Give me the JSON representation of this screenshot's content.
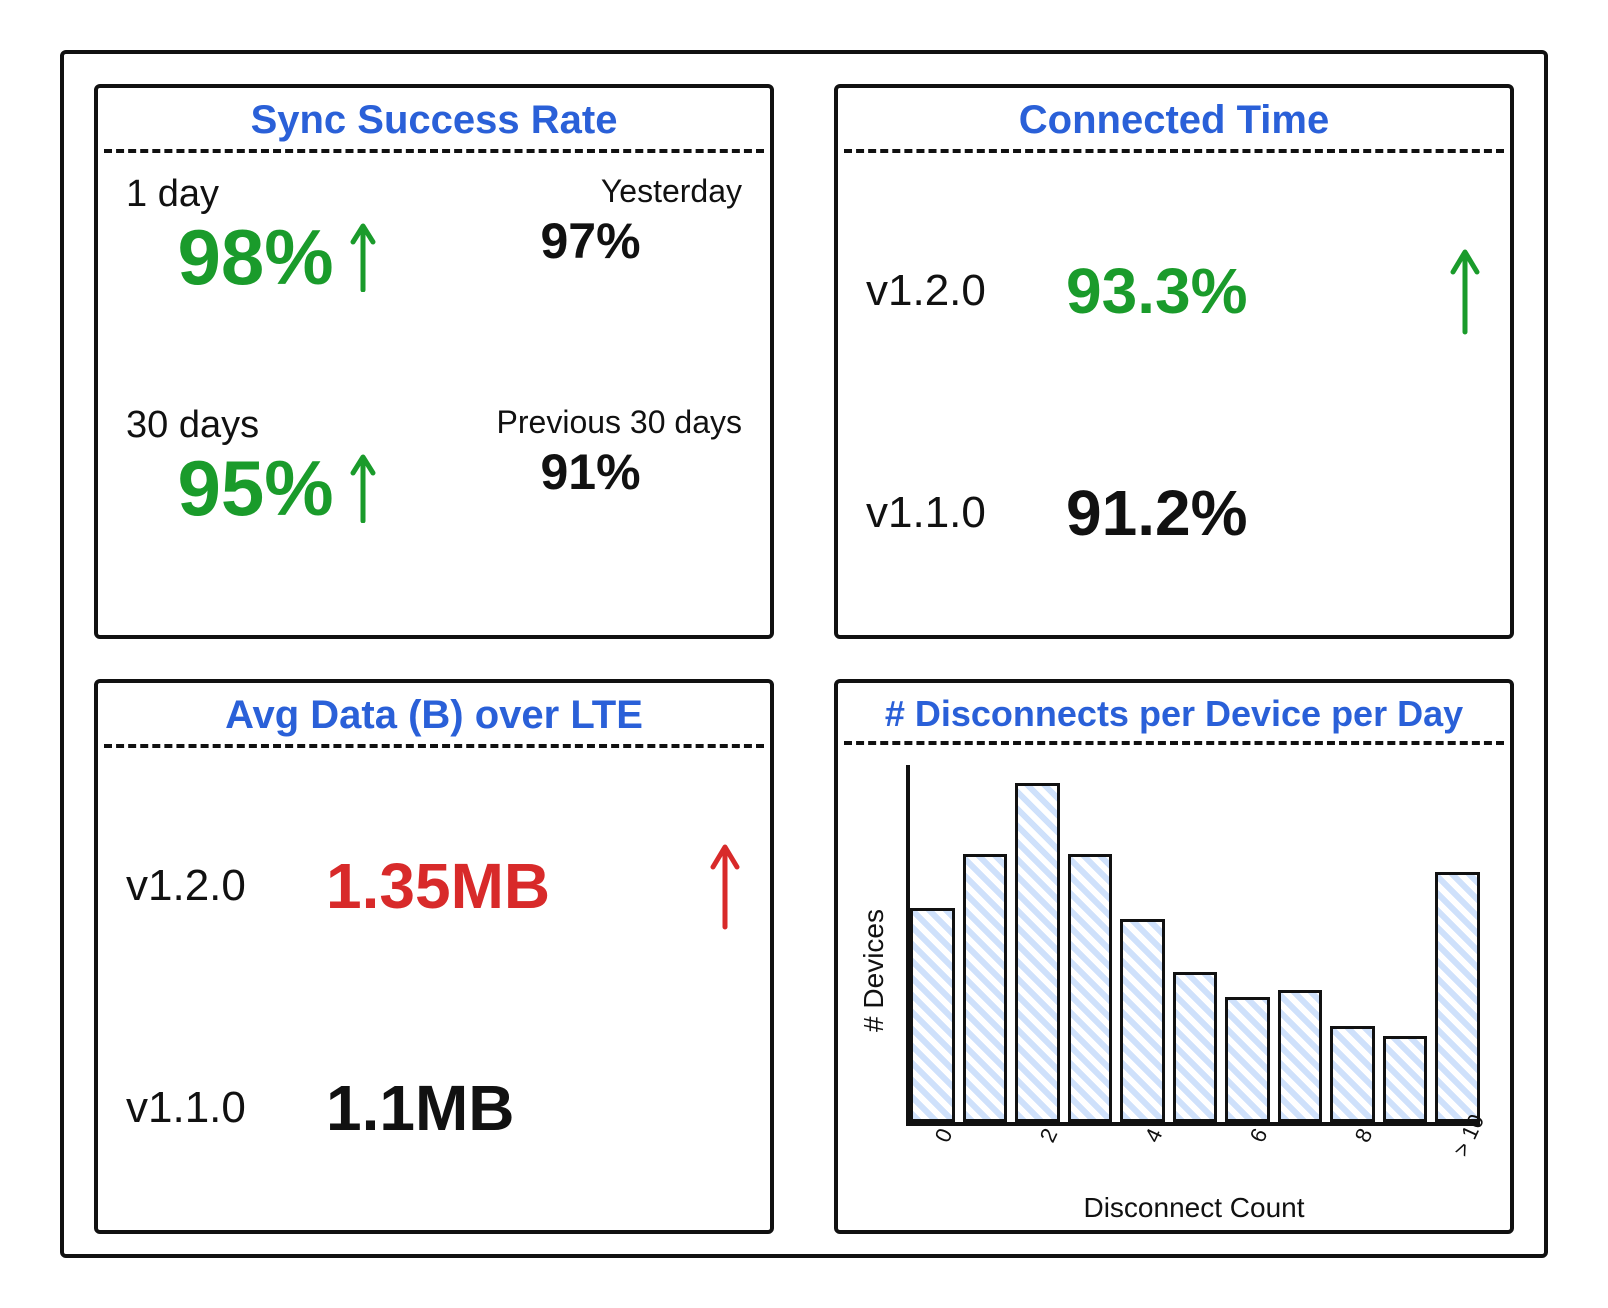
{
  "colors": {
    "accent_blue": "#2a60d8",
    "positive_green": "#1a9b2b",
    "negative_red": "#d82a2a",
    "ink": "#111111"
  },
  "cards": {
    "sync": {
      "title": "Sync Success Rate",
      "rows": [
        {
          "period_label": "1 day",
          "value": "98%",
          "trend": "up",
          "compare_label": "Yesterday",
          "compare_value": "97%"
        },
        {
          "period_label": "30 days",
          "value": "95%",
          "trend": "up",
          "compare_label": "Previous 30 days",
          "compare_value": "91%"
        }
      ]
    },
    "connected": {
      "title": "Connected Time",
      "current": {
        "version": "v1.2.0",
        "value": "93.3%",
        "trend": "up"
      },
      "previous": {
        "version": "v1.1.0",
        "value": "91.2%"
      }
    },
    "avg_data": {
      "title": "Avg Data (B) over LTE",
      "current": {
        "version": "v1.2.0",
        "value": "1.35MB",
        "trend": "up_bad"
      },
      "previous": {
        "version": "v1.1.0",
        "value": "1.1MB"
      }
    },
    "disconnects": {
      "title": "# Disconnects per Device per Day",
      "ylabel": "# Devices",
      "xlabel": "Disconnect Count"
    }
  },
  "chart_data": {
    "type": "bar",
    "title": "# Disconnects per Device per Day",
    "xlabel": "Disconnect Count",
    "ylabel": "# Devices",
    "categories": [
      "0",
      "",
      "2",
      "",
      "4",
      "",
      "6",
      "",
      "8",
      "",
      "> 10"
    ],
    "values": [
      60,
      75,
      95,
      75,
      57,
      42,
      35,
      37,
      27,
      24,
      70
    ],
    "ylim": [
      0,
      100
    ]
  }
}
